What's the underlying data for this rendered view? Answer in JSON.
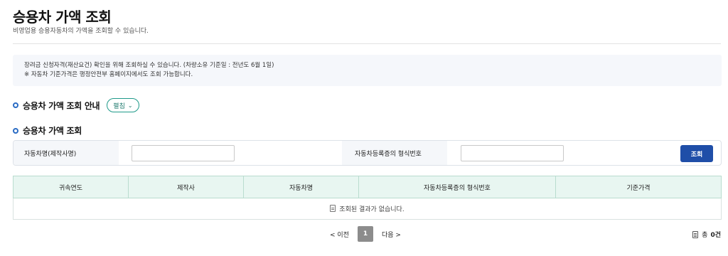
{
  "page": {
    "title": "승용차 가액 조회",
    "subtitle": "비영업용 승용자동차의 가액을 조회할 수 있습니다."
  },
  "notice": {
    "line1": "장려금 신청자격(재산요건) 확인을 위해 조회하실 수 있습니다. (차량소유 기준일 : 전년도 6월 1일)",
    "line2": "※ 자동차 기준가격은 행정안전부 홈페이지에서도 조회 가능합니다."
  },
  "guide_section": {
    "heading": "승용차 가액 조회 안내",
    "toggle_label": "펼침",
    "toggle_icon": "chevron-down-icon"
  },
  "search_section": {
    "heading": "승용차 가액 조회",
    "vehicle_name_label": "자동차명(제작사명)",
    "vehicle_name_value": "",
    "model_number_label": "자동차등록증의 형식번호",
    "model_number_value": "",
    "search_button": "조회"
  },
  "table": {
    "columns": [
      "귀속연도",
      "제작사",
      "자동차명",
      "자동차등록증의 형식번호",
      "기준가격"
    ],
    "empty_message": "조회된 결과가 없습니다."
  },
  "pagination": {
    "prev": "< 이전",
    "current_page": "1",
    "next": "다음 >"
  },
  "total": {
    "label": "총",
    "count": "0건"
  },
  "colors": {
    "accent_blue": "#1f4ea8",
    "toggle_teal": "#1f9a8a",
    "table_header_bg": "#e8f6f1"
  }
}
